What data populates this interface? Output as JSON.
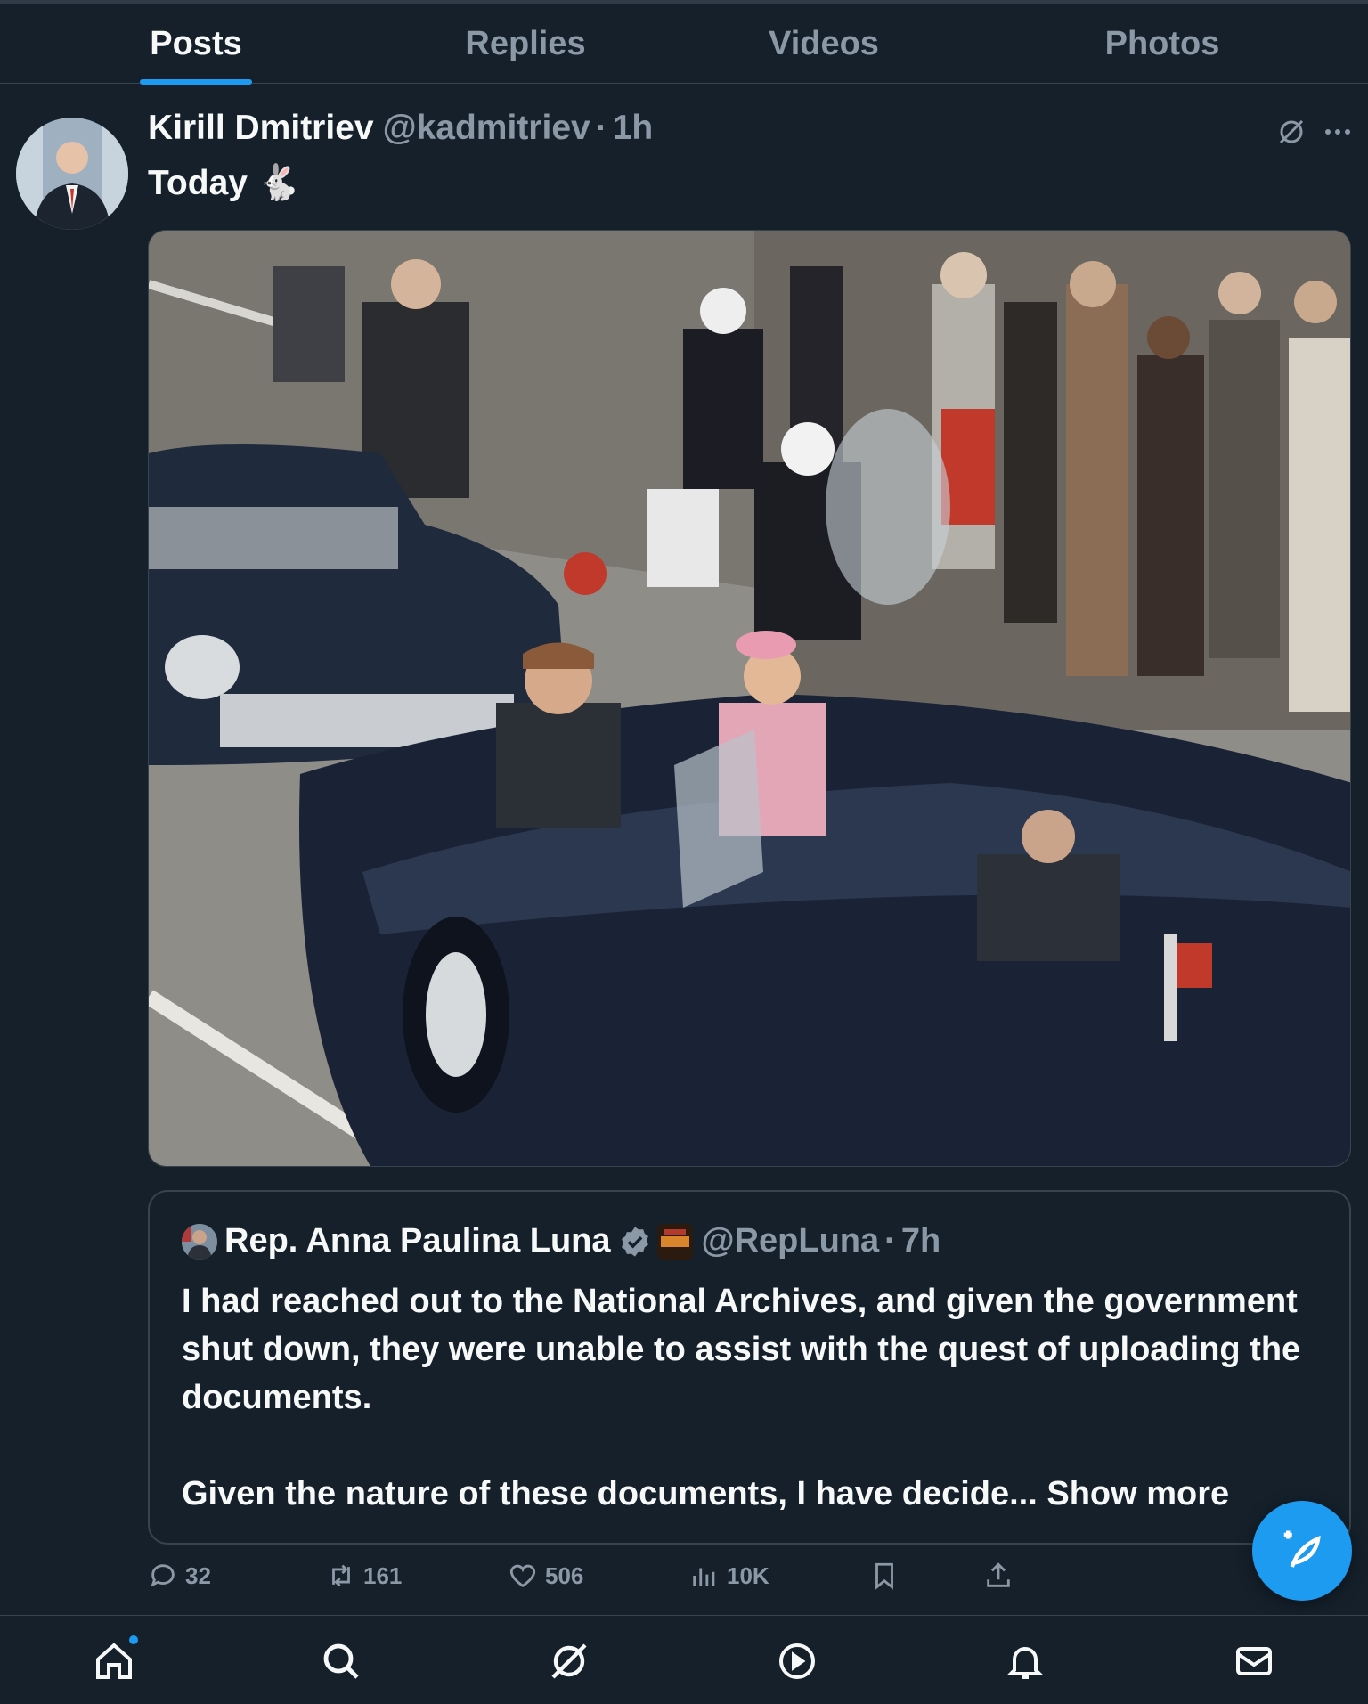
{
  "tabs": [
    {
      "label": "Posts",
      "active": true
    },
    {
      "label": "Replies",
      "active": false
    },
    {
      "label": "Videos",
      "active": false
    },
    {
      "label": "Photos",
      "active": false
    }
  ],
  "post": {
    "author_name": "Kirill Dmitriev",
    "handle": "@kadmitriev",
    "separator": "·",
    "time": "1h",
    "text": "Today 🐇",
    "image_icon": "motorcade-photo"
  },
  "quote": {
    "author_name": "Rep. Anna Paulina Luna",
    "handle": "@RepLuna",
    "separator": "·",
    "time": "7h",
    "paragraph1": "I had reached out to the National Archives, and given the government shut down, they were unable to assist with the quest of uploading the documents.",
    "paragraph2": "Given the nature of these documents, I have decide...",
    "show_more": "Show more"
  },
  "actions": {
    "replies": "32",
    "reposts": "161",
    "likes": "506",
    "views": "10K"
  },
  "colors": {
    "background": "#15202b",
    "accent": "#1d9bf0",
    "muted": "#8b98a5",
    "border": "#38444d"
  },
  "nav": [
    "home-icon",
    "search-icon",
    "grok-icon",
    "video-icon",
    "bell-icon",
    "mail-icon"
  ]
}
